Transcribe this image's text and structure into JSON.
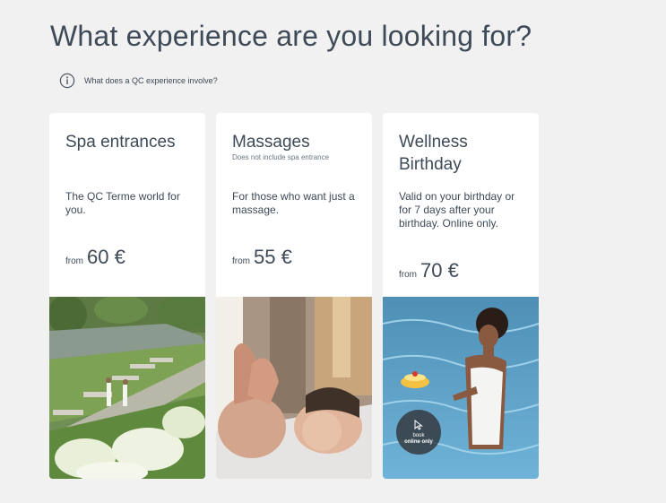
{
  "page": {
    "title": "What experience are you looking for?",
    "info_link": "What does a QC experience involve?"
  },
  "cards": [
    {
      "title": "Spa entrances",
      "note": "",
      "description": "The QC Terme world for you.",
      "price_prefix": "from",
      "price": "60 €",
      "image_icon": "spa-garden-photo"
    },
    {
      "title": "Massages",
      "note": "Does not include spa entrance",
      "description": "For those who want just a massage.",
      "price_prefix": "from",
      "price": "55 €",
      "image_icon": "massage-photo"
    },
    {
      "title": "Wellness Birthday",
      "note": "",
      "description": "Valid on your birthday or for 7 days after your birthday. Online only.",
      "price_prefix": "from",
      "price": "70 €",
      "image_icon": "pool-cake-photo",
      "badge": {
        "line1": "book",
        "line2": "online only",
        "icon": "cursor-pointer-icon"
      }
    }
  ],
  "colors": {
    "background": "#f1f1f1",
    "card": "#ffffff",
    "text": "#3e4a57",
    "badge": "#343a40"
  }
}
